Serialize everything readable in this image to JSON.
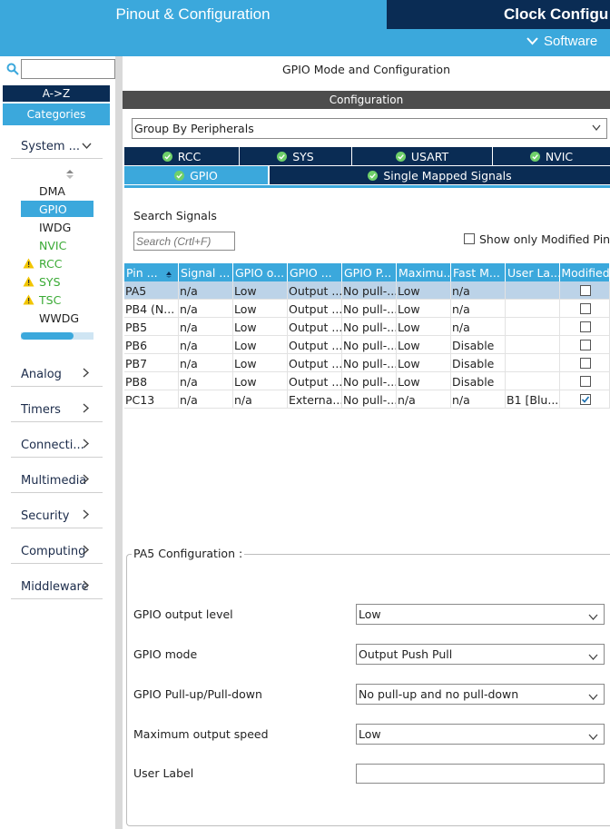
{
  "header": {
    "tab_pinout": "Pinout & Configuration",
    "tab_clock": "Clock Configu",
    "software": "Software"
  },
  "sidebar": {
    "search_value": "",
    "az_label": "A->Z",
    "categories_label": "Categories",
    "system_label": "System ...",
    "peripherals": [
      {
        "label": "DMA",
        "state": "normal"
      },
      {
        "label": "GPIO",
        "state": "selected"
      },
      {
        "label": "IWDG",
        "state": "normal"
      },
      {
        "label": "NVIC",
        "state": "green"
      },
      {
        "label": "RCC",
        "state": "warning"
      },
      {
        "label": "SYS",
        "state": "warning"
      },
      {
        "label": "TSC",
        "state": "warning"
      },
      {
        "label": "WWDG",
        "state": "normal"
      }
    ],
    "categories": [
      "Analog",
      "Timers",
      "Connecti...",
      "Multimedia",
      "Security",
      "Computing",
      "Middleware"
    ]
  },
  "main": {
    "title": "GPIO Mode and Configuration",
    "config_bar": "Configuration",
    "group_by": "Group By Peripherals",
    "tabs_row1": [
      "RCC",
      "SYS",
      "USART",
      "NVIC"
    ],
    "tabs_row2": [
      "GPIO",
      "Single Mapped Signals"
    ],
    "search_label": "Search Signals",
    "search_placeholder": "Search (Crtl+F)",
    "show_modified": "Show only Modified Pins"
  },
  "table": {
    "headers": [
      "Pin ...",
      "Signal ...",
      "GPIO o...",
      "GPIO ...",
      "GPIO P...",
      "Maximu...",
      "Fast M...",
      "User La...",
      "Modified"
    ],
    "rows": [
      {
        "cells": [
          "PA5",
          "n/a",
          "Low",
          "Output ...",
          "No pull-...",
          "Low",
          "n/a",
          ""
        ],
        "modified": false,
        "selected": true
      },
      {
        "cells": [
          "PB4 (N...",
          "n/a",
          "Low",
          "Output ...",
          "No pull-...",
          "Low",
          "n/a",
          ""
        ],
        "modified": false,
        "selected": false
      },
      {
        "cells": [
          "PB5",
          "n/a",
          "Low",
          "Output ...",
          "No pull-...",
          "Low",
          "n/a",
          ""
        ],
        "modified": false,
        "selected": false
      },
      {
        "cells": [
          "PB6",
          "n/a",
          "Low",
          "Output ...",
          "No pull-...",
          "Low",
          "Disable",
          ""
        ],
        "modified": false,
        "selected": false
      },
      {
        "cells": [
          "PB7",
          "n/a",
          "Low",
          "Output ...",
          "No pull-...",
          "Low",
          "Disable",
          ""
        ],
        "modified": false,
        "selected": false
      },
      {
        "cells": [
          "PB8",
          "n/a",
          "Low",
          "Output ...",
          "No pull-...",
          "Low",
          "Disable",
          ""
        ],
        "modified": false,
        "selected": false
      },
      {
        "cells": [
          "PC13",
          "n/a",
          "n/a",
          "Externa...",
          "No pull-...",
          "n/a",
          "n/a",
          "B1 [Blu..."
        ],
        "modified": true,
        "selected": false
      }
    ]
  },
  "pin_config": {
    "title": "PA5 Configuration :",
    "fields": [
      {
        "label": "GPIO output level",
        "value": "Low"
      },
      {
        "label": "GPIO mode",
        "value": "Output Push Pull"
      },
      {
        "label": "GPIO Pull-up/Pull-down",
        "value": "No pull-up and no pull-down"
      },
      {
        "label": "Maximum output speed",
        "value": "Low"
      }
    ],
    "user_label": "User Label",
    "user_label_value": ""
  },
  "colors": {
    "accent": "#3ba8dc",
    "navy": "#0a2c54",
    "config_bar": "#4d4d4d",
    "selected_row": "#bcd3e8",
    "warning": "#f2c500",
    "green": "#3aaa35"
  }
}
